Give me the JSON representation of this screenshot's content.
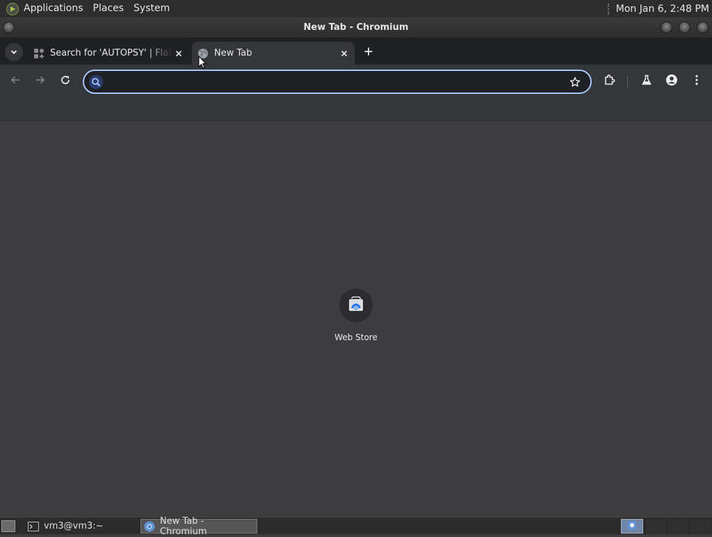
{
  "top_panel": {
    "menus": [
      "Applications",
      "Places",
      "System"
    ],
    "clock": "Mon Jan  6,  2:48 PM"
  },
  "window": {
    "title": "New Tab - Chromium"
  },
  "tabs": [
    {
      "title": "Search for 'AUTOPSY' | Flathub",
      "favicon": "flathub-icon",
      "active": false
    },
    {
      "title": "New Tab",
      "favicon": "globe-icon",
      "active": true
    }
  ],
  "toolbar": {
    "omnibox_value": "",
    "omnibox_placeholder": ""
  },
  "ntp": {
    "shortcuts": [
      {
        "label": "Web Store",
        "icon": "webstore-icon"
      }
    ]
  },
  "taskbar": {
    "tasks": [
      {
        "label": "vm3@vm3:~",
        "icon": "terminal-icon",
        "active": false
      },
      {
        "label": "New Tab - Chromium",
        "icon": "chromium-icon",
        "active": true
      }
    ]
  },
  "colors": {
    "accent": "#a8c7fa",
    "tab_active_bg": "#35363a",
    "tabstrip_bg": "#202124",
    "ntp_bg": "#3d3d40"
  }
}
